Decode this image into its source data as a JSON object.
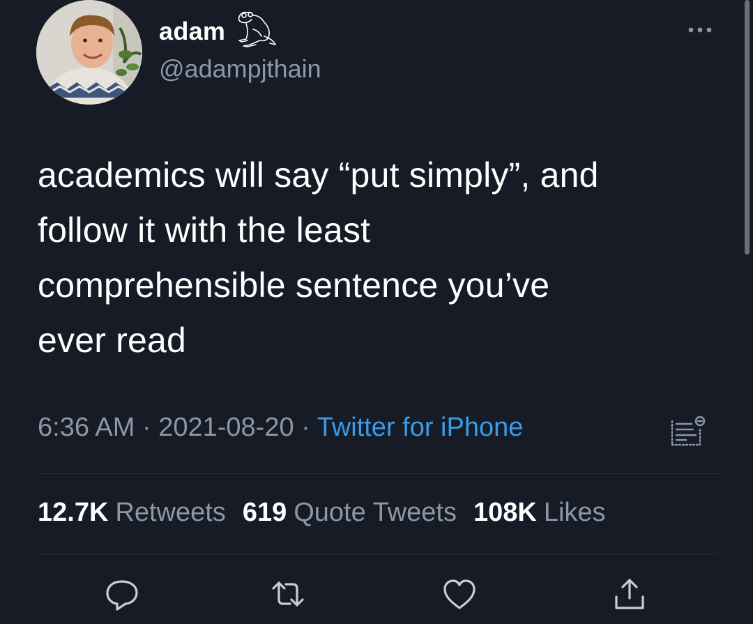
{
  "author": {
    "display_name": "adam",
    "handle": "@adampjthain",
    "name_badge_icon": "frog-icon",
    "avatar": "profile-photo"
  },
  "tweet": {
    "text": "academics will say “put simply”, and\nfollow it with the least\ncomprehensible sentence you’ve\never read",
    "time": "6:36 AM",
    "separator": " · ",
    "date": "2021-08-20",
    "source": "Twitter for iPhone"
  },
  "stats": [
    {
      "value": "12.7K",
      "label": "Retweets"
    },
    {
      "value": "619",
      "label": "Quote Tweets"
    },
    {
      "value": "108K",
      "label": "Likes"
    }
  ],
  "actions": [
    {
      "icon": "reply-icon"
    },
    {
      "icon": "retweet-icon"
    },
    {
      "icon": "like-icon"
    },
    {
      "icon": "share-icon"
    }
  ],
  "colors": {
    "background": "#161b25",
    "text": "#ffffff",
    "secondary": "#8b98a5",
    "link": "#3a9ce8",
    "divider": "#2f3640"
  }
}
